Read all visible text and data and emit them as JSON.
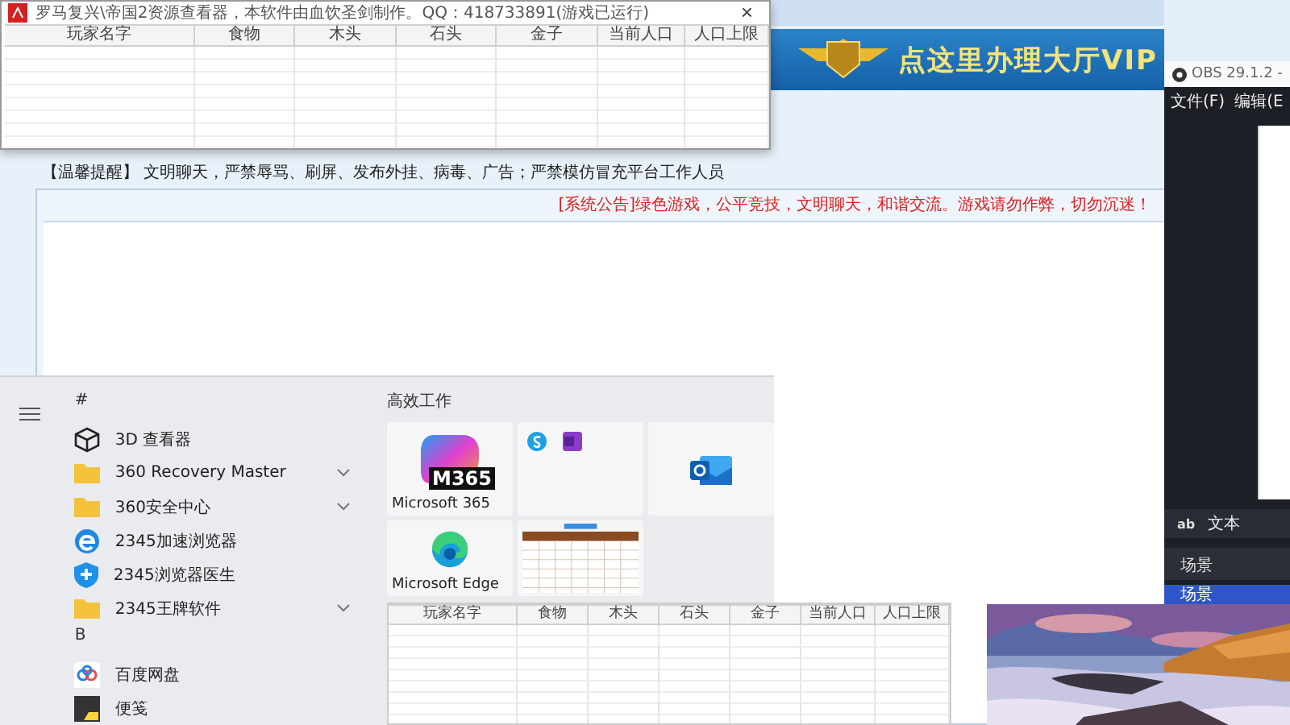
{
  "page": {
    "banner": "点这里办理大厅VIP",
    "reminder": "【温馨提醒】 文明聊天，严禁辱骂、刷屏、发布外挂、病毒、广告；严禁模仿冒充平台工作人员",
    "notice": "[系统公告]绿色游戏，公平竞技，文明聊天，和谐交流。游戏请勿作弊，切勿沉迷！"
  },
  "viewer": {
    "title": "罗马复兴\\帝国2资源查看器，本软件由血饮圣剑制作。QQ：418733891(游戏已运行)",
    "close": "×",
    "columns": [
      "玩家名字",
      "食物",
      "木头",
      "石头",
      "金子",
      "当前人口",
      "人口上限"
    ]
  },
  "start_menu": {
    "sections": [
      {
        "letter": "#",
        "items": [
          {
            "label": "3D 查看器",
            "kind": "cube"
          },
          {
            "label": "360 Recovery Master",
            "kind": "folder"
          },
          {
            "label": "360安全中心",
            "kind": "folder"
          },
          {
            "label": "2345加速浏览器",
            "kind": "browser"
          },
          {
            "label": "2345浏览器医生",
            "kind": "shield"
          },
          {
            "label": "2345王牌软件",
            "kind": "folder"
          }
        ]
      },
      {
        "letter": "B",
        "items": [
          {
            "label": "百度网盘",
            "kind": "cloud"
          },
          {
            "label": "便笺",
            "kind": "note"
          }
        ]
      }
    ],
    "tiles_heading": "高效工作",
    "tiles": [
      {
        "kind": "m365",
        "label": "Microsoft 365",
        "badge": "M365"
      },
      {
        "kind": "apps"
      },
      {
        "kind": "outlook"
      },
      {
        "kind": "edge",
        "label": "Microsoft Edge"
      },
      {
        "kind": "sheet"
      }
    ]
  },
  "table2": {
    "columns": [
      "玩家名字",
      "食物",
      "木头",
      "石头",
      "金子",
      "当前人口",
      "人口上限"
    ]
  },
  "obs": {
    "title": "OBS 29.1.2 -",
    "menus": [
      "文件(F)",
      "编辑(E"
    ],
    "sources": [
      {
        "icon": "ab",
        "label": "文本"
      }
    ],
    "scenes_header": "场景",
    "scenes": [
      {
        "label": "场景",
        "selected": true
      }
    ]
  }
}
